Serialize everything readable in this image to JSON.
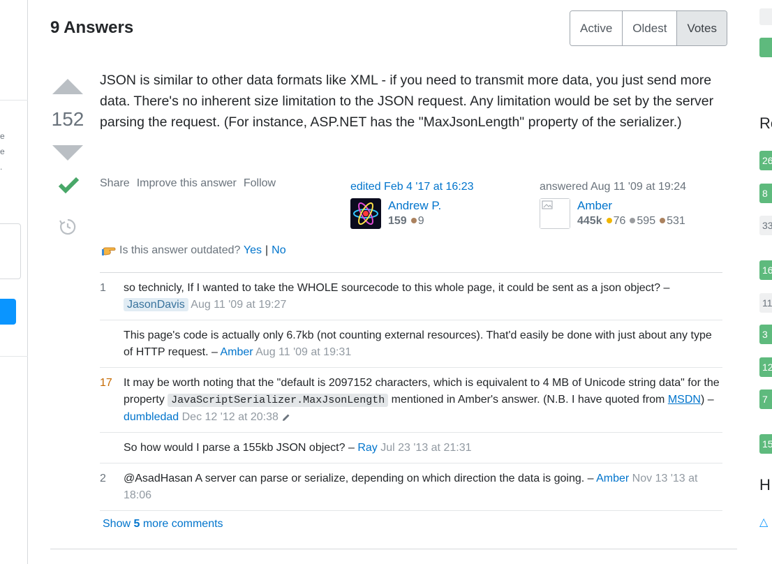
{
  "left_sidebar": {
    "fragments": [
      "e",
      "e",
      "."
    ]
  },
  "answers": {
    "header": "9 Answers",
    "sort_options": [
      "Active",
      "Oldest",
      "Votes"
    ],
    "selected_sort": "Votes"
  },
  "answer": {
    "score": "152",
    "accepted": true,
    "body": "JSON is similar to other data formats like XML - if you need to transmit more data, you just send more data. There's no inherent size limitation to the JSON request. Any limitation would be set by the server parsing the request. (For instance, ASP.NET has the \"MaxJsonLength\" property of the serializer.)",
    "menu": {
      "share": "Share",
      "improve": "Improve this answer",
      "follow": "Follow"
    },
    "edited": {
      "action": "edited Feb 4 '17 at 16:23",
      "user": "Andrew P.",
      "reputation": "159",
      "bronze": "9"
    },
    "answered": {
      "action": "answered Aug 11 '09 at 19:24",
      "user": "Amber",
      "reputation": "445k",
      "gold": "76",
      "silver": "595",
      "bronze": "531"
    },
    "outdated": {
      "question": "Is this answer outdated?",
      "yes": "Yes",
      "separator": "|",
      "no": "No"
    }
  },
  "comments": [
    {
      "score": "1",
      "text": "so technicly, If I wanted to take the WHOLE sourcecode to this whole page, it could be sent as a json object? –",
      "author": "JasonDavis",
      "date": "Aug 11 '09 at 19:27"
    },
    {
      "score": "",
      "text": "This page's code is actually only 6.7kb (not counting external resources). That'd easily be done with just about any type of HTTP request. –",
      "author": "Amber",
      "date": "Aug 11 '09 at 19:31"
    },
    {
      "score": "17",
      "text_before": "It may be worth noting that the \"default is 2097152 characters, which is equivalent to 4 MB of Unicode string data\" for the property",
      "code": "JavaScriptSerializer.MaxJsonLength",
      "text_middle": "mentioned in Amber's answer. (N.B. I have quoted from",
      "link": "MSDN",
      "text_after": ") –",
      "author": "dumbledad",
      "date": "Dec 12 '12 at 20:38"
    },
    {
      "score": "",
      "text": "So how would I parse a 155kb JSON object? –",
      "author": "Ray",
      "date": "Jul 23 '13 at 21:31"
    },
    {
      "score": "2",
      "text": "@AsadHasan A server can parse or serialize, depending on which direction the data is going. –",
      "author": "Amber",
      "date": "Nov 13 '13 at 18:06"
    }
  ],
  "show_more": {
    "prefix": "Show",
    "count": "5",
    "suffix": "more comments"
  },
  "right_sidebar": {
    "heading_1": "Re",
    "chips": [
      "26",
      "8",
      "33",
      "16",
      "11",
      "3",
      "12",
      "7",
      "15"
    ],
    "heading_2": "H"
  }
}
